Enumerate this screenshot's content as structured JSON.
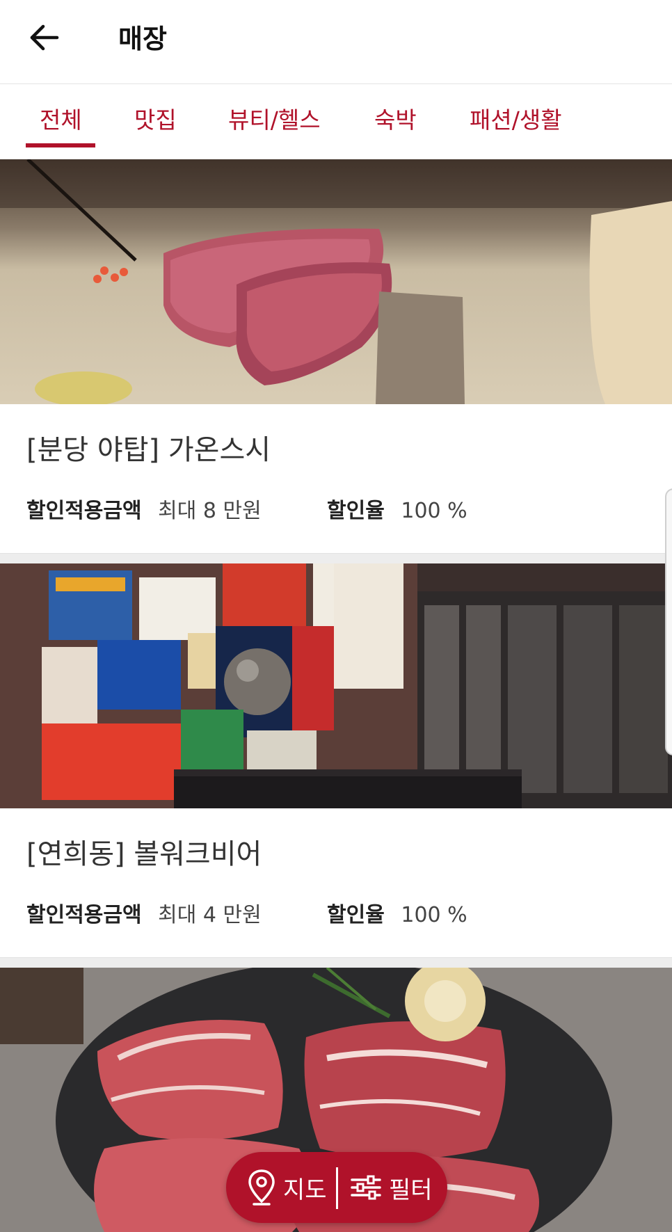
{
  "header": {
    "title": "매장",
    "back_icon": "arrow-left-icon"
  },
  "tabs": [
    {
      "label": "전체",
      "active": true
    },
    {
      "label": "맛집",
      "active": false
    },
    {
      "label": "뷰티/헬스",
      "active": false
    },
    {
      "label": "숙박",
      "active": false
    },
    {
      "label": "패션/생활",
      "active": false
    }
  ],
  "stores": [
    {
      "name": "[분당 야탑] 가온스시",
      "discount_amount_label": "할인적용금액",
      "discount_amount_value": "최대 8 만원",
      "discount_rate_label": "할인율",
      "discount_rate_value": "100 %"
    },
    {
      "name": "[연희동] 볼워크비어",
      "discount_amount_label": "할인적용금액",
      "discount_amount_value": "최대 4 만원",
      "discount_rate_label": "할인율",
      "discount_rate_value": "100 %"
    },
    {
      "name": "",
      "discount_amount_label": "",
      "discount_amount_value": "",
      "discount_rate_label": "",
      "discount_rate_value": ""
    }
  ],
  "fab": {
    "map_label": "지도",
    "filter_label": "필터",
    "map_icon": "map-pin-icon",
    "filter_icon": "sliders-icon"
  },
  "colors": {
    "accent": "#b0122a",
    "background": "#ededed"
  }
}
